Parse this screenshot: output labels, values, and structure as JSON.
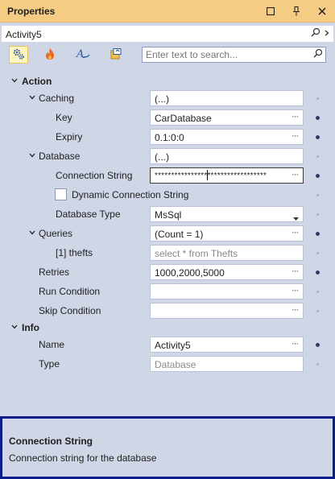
{
  "window": {
    "title": "Properties"
  },
  "object_selector": {
    "name": "Activity5"
  },
  "search": {
    "placeholder": "Enter text to search..."
  },
  "categories": [
    {
      "name": "Action",
      "rows": [
        {
          "id": "caching",
          "label": "Caching",
          "value": "(...)",
          "expandable": true
        },
        {
          "id": "key",
          "label": "Key",
          "value": "CarDatabase",
          "ellipsis": true
        },
        {
          "id": "expiry",
          "label": "Expiry",
          "value": "0.1:0:0",
          "ellipsis": true
        },
        {
          "id": "database",
          "label": "Database",
          "value": "(...)",
          "expandable": true
        },
        {
          "id": "connection-string",
          "label": "Connection String",
          "value": "**********************************",
          "ellipsis": true
        },
        {
          "id": "dynamic-connection-string",
          "label": "Dynamic Connection String",
          "checked": false
        },
        {
          "id": "database-type",
          "label": "Database Type",
          "value": "MsSql",
          "dropdown": true
        },
        {
          "id": "queries",
          "label": "Queries",
          "value": "(Count = 1)",
          "ellipsis": true,
          "expandable": true
        },
        {
          "id": "query-1",
          "label": "[1] thefts",
          "value": "select * from Thefts",
          "placeholder_style": true
        },
        {
          "id": "retries",
          "label": "Retries",
          "value": "1000,2000,5000",
          "ellipsis": true
        },
        {
          "id": "run-condition",
          "label": "Run Condition",
          "value": "",
          "ellipsis": true
        },
        {
          "id": "skip-condition",
          "label": "Skip Condition",
          "value": "",
          "ellipsis": true
        }
      ]
    },
    {
      "name": "Info",
      "rows": [
        {
          "id": "name",
          "label": "Name",
          "value": "Activity5",
          "ellipsis": true
        },
        {
          "id": "type",
          "label": "Type",
          "value": "Database",
          "placeholder_style": true
        }
      ]
    }
  ],
  "description": {
    "title": "Connection String",
    "text": "Connection string for the database"
  },
  "colors": {
    "title_bar": "#f5cc84",
    "panel_background": "#cfd6e5",
    "description_border": "#0b1c8c",
    "modified_dot": "#2f3d63"
  }
}
